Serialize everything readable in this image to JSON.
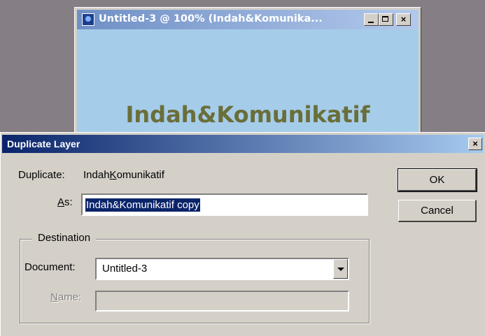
{
  "document_window": {
    "title": "Untitled-3 @ 100% (Indah&Komunika...",
    "canvas_text": "Indah&Komunikatif",
    "minimize": "_",
    "close": "×"
  },
  "dialog": {
    "title": "Duplicate Layer",
    "close": "×",
    "duplicate_label": "Duplicate:",
    "duplicate_value_pre": "Indah",
    "duplicate_value_mnemonic": "K",
    "duplicate_value_post": "omunikatif",
    "as_label_mnemonic": "A",
    "as_label_rest": "s:",
    "as_value": "Indah&Komunikatif copy",
    "ok_label": "OK",
    "cancel_label": "Cancel",
    "destination_legend": "Destination",
    "document_label": "Document:",
    "document_value": "Untitled-3",
    "name_label_mnemonic": "N",
    "name_label_rest": "ame:",
    "name_value": ""
  },
  "colors": {
    "desktop": "#857e84",
    "dialog_title_start": "#0a246a",
    "dialog_title_end": "#a6caf0",
    "canvas_bg": "#a5cce9",
    "canvas_text": "#6a6e39",
    "selection": "#0a246a"
  },
  "icons": {
    "doc_app": "photoshop-doc-icon",
    "dropdown": "chevron-down-icon"
  }
}
